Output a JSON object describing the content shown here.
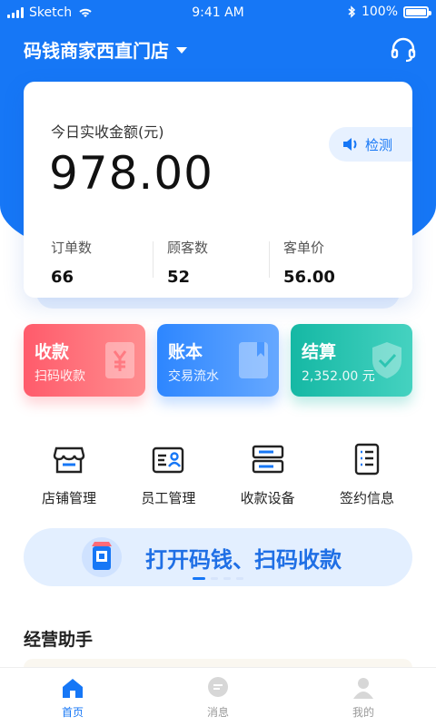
{
  "status_bar": {
    "carrier": "Sketch",
    "time": "9:41 AM",
    "battery": "100%"
  },
  "header": {
    "store_name": "码钱商家西直门店",
    "icons": {
      "dropdown": "caret-down-icon",
      "support": "headset-icon"
    }
  },
  "summary": {
    "label": "今日实收金额(元)",
    "amount": "978.00",
    "detect_label": "检测",
    "stats": [
      {
        "label": "订单数",
        "value": "66"
      },
      {
        "label": "顾客数",
        "value": "52"
      },
      {
        "label": "客单价",
        "value": "56.00"
      }
    ]
  },
  "tiles": [
    {
      "title": "收款",
      "subtitle": "扫码收款",
      "color": "#ff5b6b"
    },
    {
      "title": "账本",
      "subtitle": "交易流水",
      "color": "#2d86ff"
    },
    {
      "title": "结算",
      "subtitle": "2,352.00 元",
      "color": "#15b8a4"
    }
  ],
  "quick_actions": [
    {
      "label": "店铺管理",
      "icon": "store-icon"
    },
    {
      "label": "员工管理",
      "icon": "staff-card-icon"
    },
    {
      "label": "收款设备",
      "icon": "device-icon"
    },
    {
      "label": "签约信息",
      "icon": "contract-icon"
    }
  ],
  "banner": {
    "text": "打开码钱、扫码收款"
  },
  "section": {
    "title": "经营助手"
  },
  "tabbar": [
    {
      "label": "首页",
      "icon": "home-icon",
      "active": true
    },
    {
      "label": "消息",
      "icon": "message-icon",
      "active": false
    },
    {
      "label": "我的",
      "icon": "user-icon",
      "active": false
    }
  ],
  "colors": {
    "primary": "#1677f6"
  }
}
